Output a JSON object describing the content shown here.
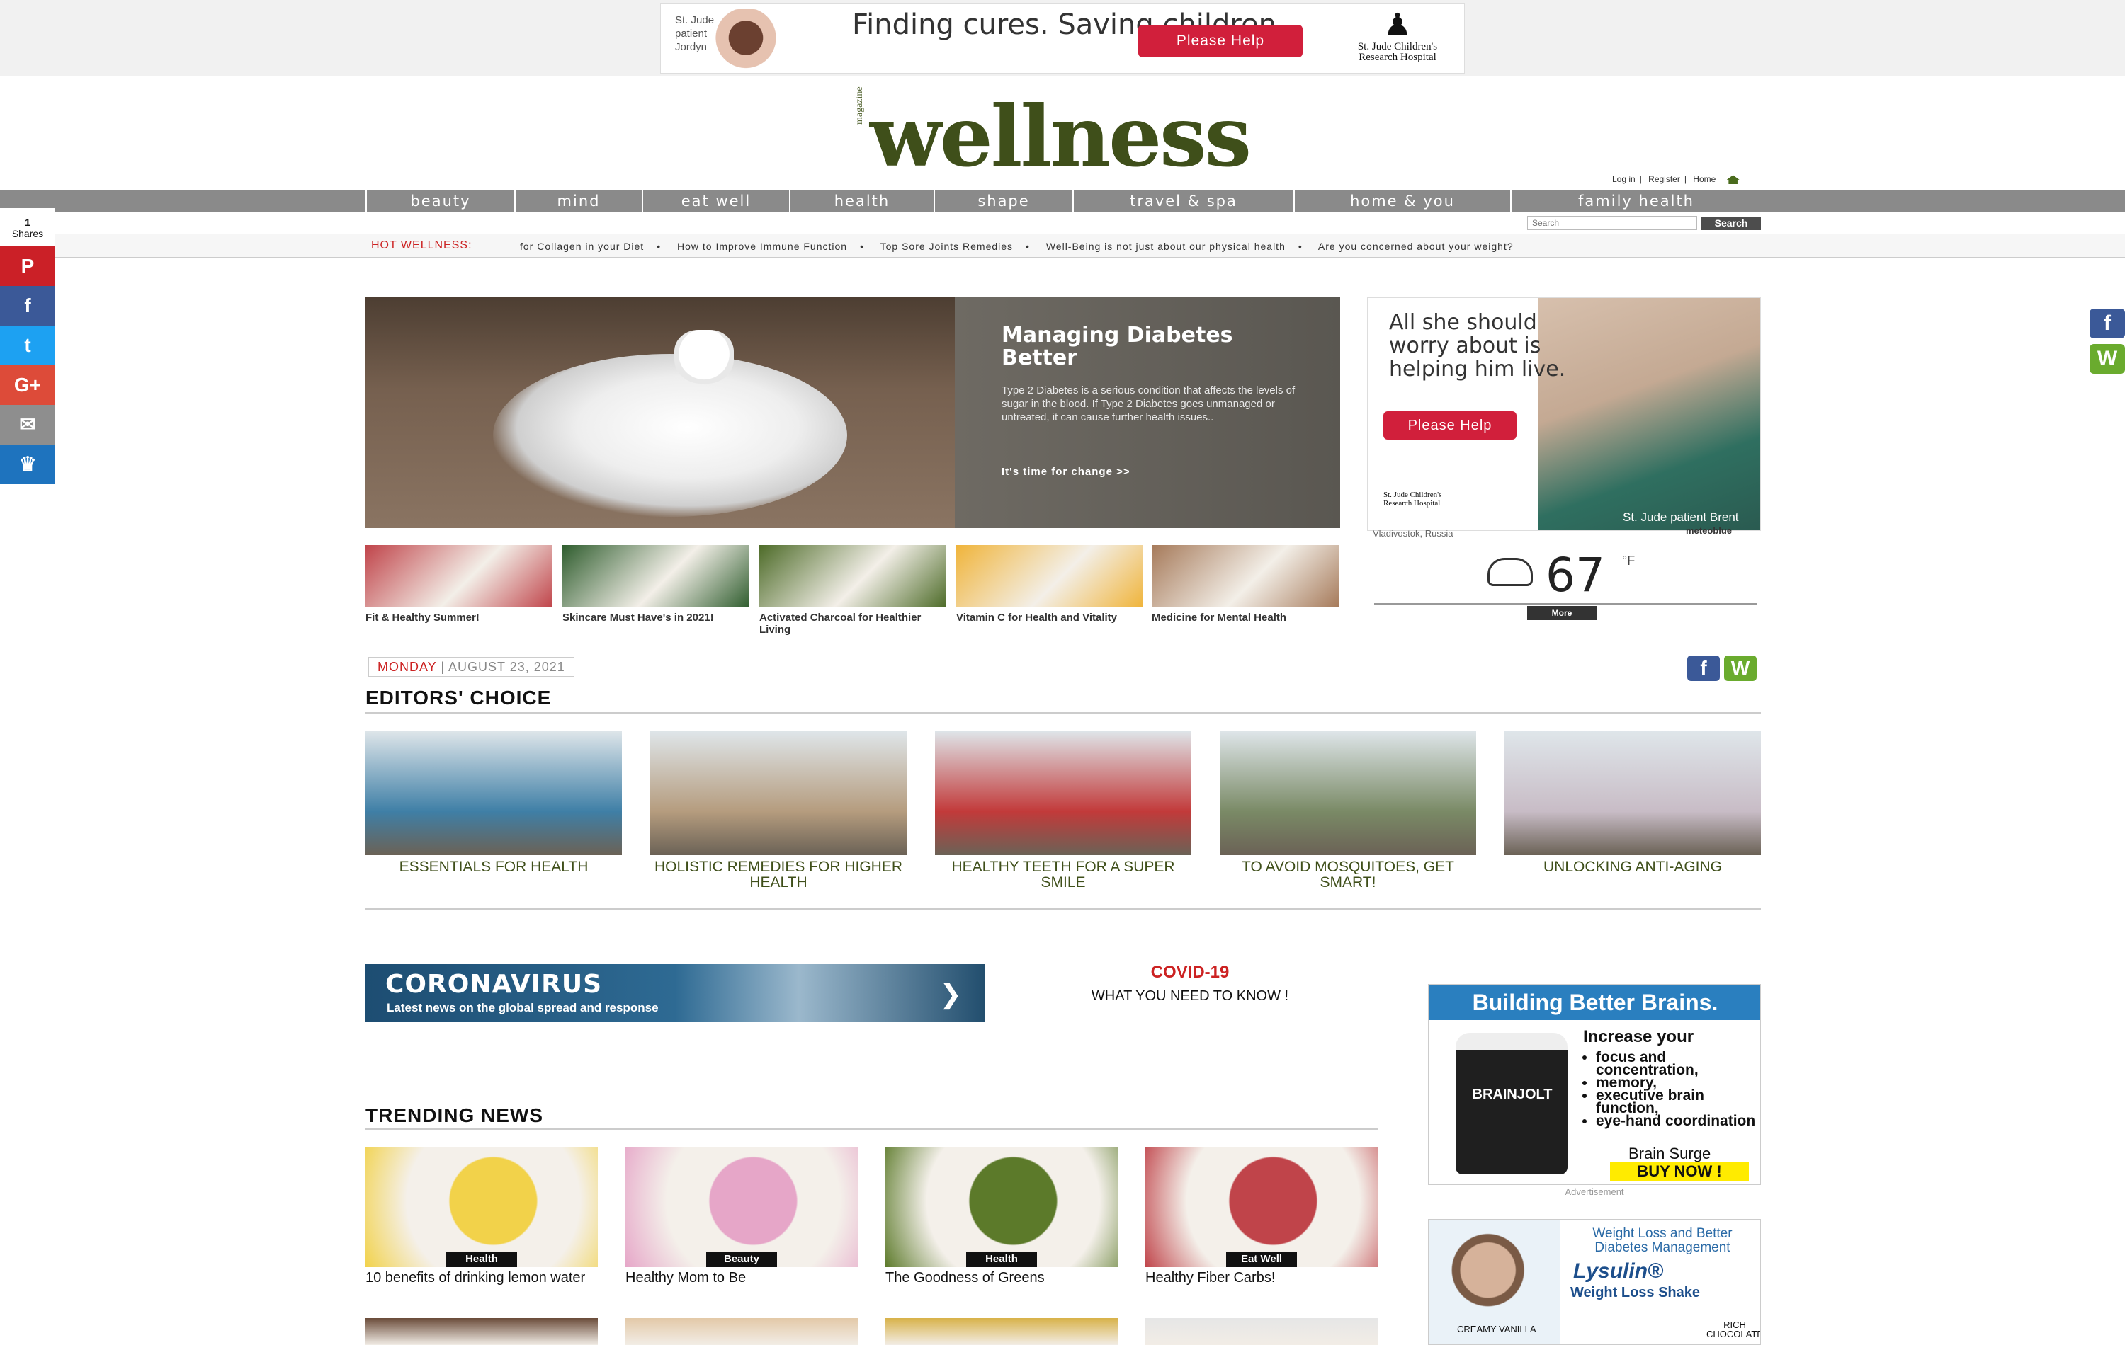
{
  "top_ad": {
    "kid_label": "St. Jude patient Jordyn",
    "slogan": "Finding cures. Saving children.",
    "button": "Please Help",
    "logo": "St. Jude Children's Research Hospital"
  },
  "brand": {
    "name": "wellness",
    "small": "magazine"
  },
  "user_links": {
    "login": "Log in",
    "register": "Register",
    "home": "Home"
  },
  "nav": [
    "beauty",
    "mind",
    "eat well",
    "health",
    "shape",
    "travel & spa",
    "home & you",
    "family health"
  ],
  "search": {
    "placeholder": "Search",
    "button": "Search"
  },
  "hot": {
    "label": "HOT WELLNESS:",
    "items": [
      "for Collagen in your Diet",
      "How to Improve Immune Function",
      "Top Sore Joints Remedies",
      "Well-Being is not just about our physical health",
      "Are you concerned about your weight?"
    ]
  },
  "shares": {
    "count": "1",
    "label": "Shares",
    "pinterest_count": "1",
    "buttons": [
      {
        "name": "pinterest-share-button",
        "glyph": "P",
        "color": "#cb2027"
      },
      {
        "name": "facebook-share-button",
        "glyph": "f",
        "color": "#3b5998"
      },
      {
        "name": "twitter-share-button",
        "glyph": "t",
        "color": "#1da1f2"
      },
      {
        "name": "google-plus-share-button",
        "glyph": "G+",
        "color": "#dd4b39"
      },
      {
        "name": "email-share-button",
        "glyph": "✉",
        "color": "#8e8e8e"
      },
      {
        "name": "sumo-share-button",
        "glyph": "♛",
        "color": "#1e73be"
      }
    ]
  },
  "hero": {
    "title": "Managing Diabetes Better",
    "body": "Type 2 Diabetes is a serious condition that affects the levels of sugar in the blood. If Type 2 Diabetes goes unmanaged or untreated, it can cause further health issues..",
    "link": "It's time for change >>"
  },
  "side_ad": {
    "text": "All she should worry about is helping him live.",
    "button": "Please Help",
    "patient": "St. Jude patient Brent",
    "logo": "St. Jude Children's Research Hospital"
  },
  "weather": {
    "city": "Vladivostok, Russia",
    "brand": "meteoblue",
    "temp": "67",
    "unit": "°F",
    "more": "More"
  },
  "thumbs": [
    {
      "caption": "Fit & Healthy Summer!",
      "color": "#c0444a"
    },
    {
      "caption": "Skincare Must Have's in 2021!",
      "color": "#2f5d2e"
    },
    {
      "caption": "Activated Charcoal for Healthier Living",
      "color": "#4d6b28"
    },
    {
      "caption": "Vitamin C for Health and Vitality",
      "color": "#f0b43a"
    },
    {
      "caption": "Medicine for Mental Health",
      "color": "#a67a5a"
    }
  ],
  "date": {
    "day": "MONDAY",
    "date": "AUGUST 23, 2021"
  },
  "editors": {
    "title": "EDITORS' CHOICE",
    "items": [
      {
        "caption": "ESSENTIALS FOR HEALTH",
        "color": "#3f7fa6"
      },
      {
        "caption": "HOLISTIC REMEDIES FOR HIGHER HEALTH",
        "color": "#b59c7e"
      },
      {
        "caption": "HEALTHY TEETH FOR A SUPER SMILE",
        "color": "#c23a3a"
      },
      {
        "caption": "TO AVOID MOSQUITOES, GET SMART!",
        "color": "#7a8a66"
      },
      {
        "caption": "UNLOCKING ANTI-AGING",
        "color": "#c8bcc6"
      }
    ]
  },
  "covid": {
    "banner_title": "CORONAVIRUS",
    "banner_sub": "Latest news on the global spread and response",
    "title": "COVID-19",
    "sub": "WHAT YOU NEED TO KNOW !"
  },
  "trending": {
    "title": "TRENDING NEWS",
    "items": [
      {
        "tag": "Health",
        "caption": "10 benefits of drinking lemon water",
        "color": "#f2d24a"
      },
      {
        "tag": "Beauty",
        "caption": "Healthy Mom to Be",
        "color": "#e6a6c8"
      },
      {
        "tag": "Health",
        "caption": "The Goodness of Greens",
        "color": "#5c7a2a"
      },
      {
        "tag": "Eat Well",
        "caption": "Healthy Fiber Carbs!",
        "color": "#c0444a"
      }
    ],
    "row2_colors": [
      "#6b4c3a",
      "#e3c9a8",
      "#d8b24a",
      "#e6e6e6"
    ]
  },
  "brain_ad": {
    "header": "Building Better Brains.",
    "product": "BRAINJOLT",
    "headline": "Increase your",
    "bullets": [
      "focus and concentration,",
      "memory,",
      "executive brain function,",
      "eye-hand coordination"
    ],
    "brand": "Brain Surge",
    "buy": "BUY NOW !"
  },
  "ad_label": "Advertisement",
  "lys_ad": {
    "line1": "Weight Loss and Better Diabetes Management",
    "name": "Lysulin®",
    "product": "Weight Loss Shake",
    "flavor1": "CREAMY VANILLA",
    "flavor2": "RICH CHOCOLATE"
  },
  "right_social": [
    {
      "name": "facebook-follow-icon",
      "glyph": "f",
      "color": "#3b5998"
    },
    {
      "name": "wellness-follow-icon",
      "glyph": "W",
      "color": "#6aab2e"
    }
  ]
}
